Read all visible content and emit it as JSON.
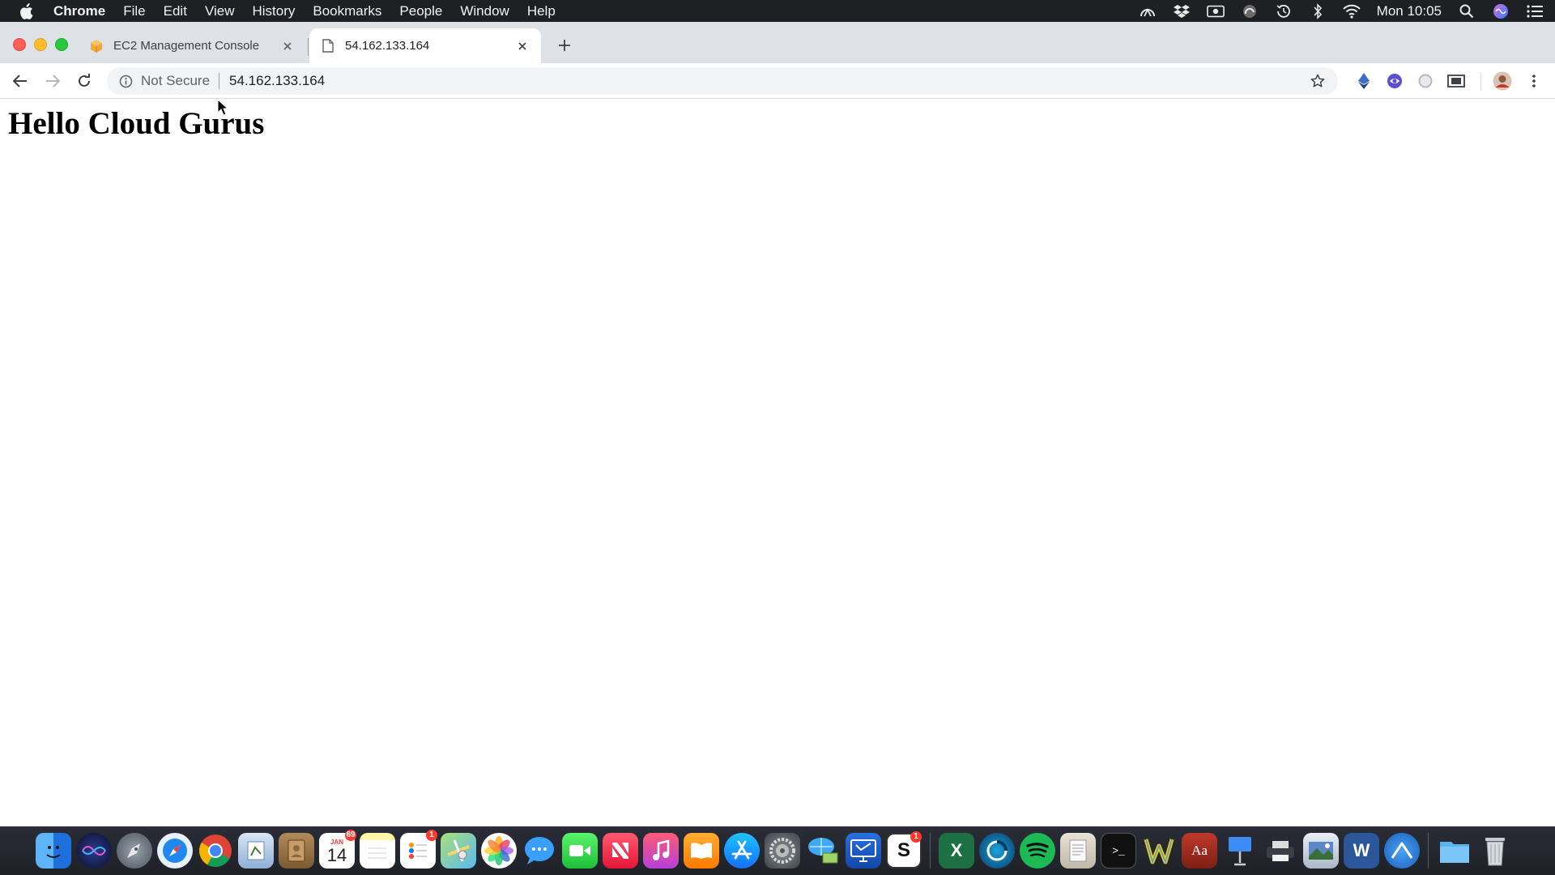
{
  "menubar": {
    "app_name": "Chrome",
    "items": [
      "File",
      "Edit",
      "View",
      "History",
      "Bookmarks",
      "People",
      "Window",
      "Help"
    ],
    "clock": "Mon 10:05"
  },
  "tabs": [
    {
      "title": "EC2 Management Console",
      "active": false
    },
    {
      "title": "54.162.133.164",
      "active": true
    }
  ],
  "omnibox": {
    "security_label": "Not Secure",
    "url": "54.162.133.164"
  },
  "page": {
    "heading": "Hello Cloud Gurus"
  },
  "dock": {
    "calendar_month": "JAN",
    "calendar_day": "14",
    "calendar_badge": "69",
    "reminders_badge": "1",
    "slack_badge": "1",
    "excel_letter": "X",
    "word_letter": "W",
    "dictionary_letter": "Aa",
    "skype_letter": "S",
    "terminal_prompt": ">_"
  },
  "colors": {
    "menubar_bg": "#1f2024",
    "tabstrip_bg": "#dee1e6",
    "omnibox_bg": "#f1f3f4",
    "page_bg": "#ffffff"
  }
}
